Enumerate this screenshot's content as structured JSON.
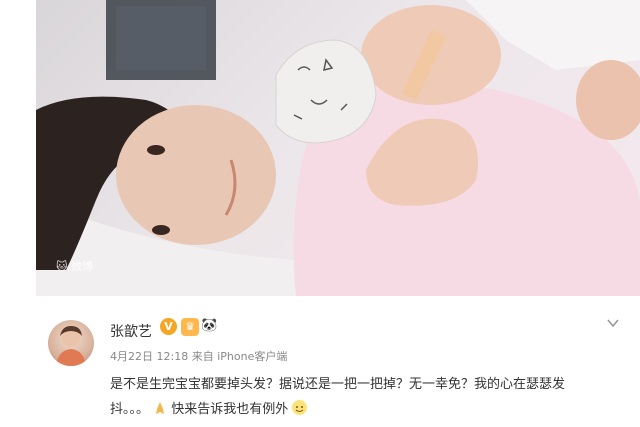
{
  "photo": {
    "watermark": "微博",
    "description_icon": "cat-face-icon"
  },
  "post": {
    "username": "张歆艺",
    "verified_badge": "V",
    "badge_2_icon": "crown-badge-icon",
    "badge_3_icon": "panda-icon",
    "date": "4月22日 12:18",
    "source_prefix": "来自",
    "source": "iPhone客户端",
    "content_line1": "是不是生完宝宝都要掉头发？据说还是一把一把掉？无一幸免？我的心在瑟瑟发",
    "content_line2_part1": "抖。。。",
    "content_line2_part2": "快来告诉我也有例外",
    "emoji_1": "pray-icon",
    "emoji_2": "smile-icon"
  },
  "colors": {
    "accent_orange": "#f5a623",
    "text_dark": "#333333",
    "text_meta": "#888888"
  }
}
